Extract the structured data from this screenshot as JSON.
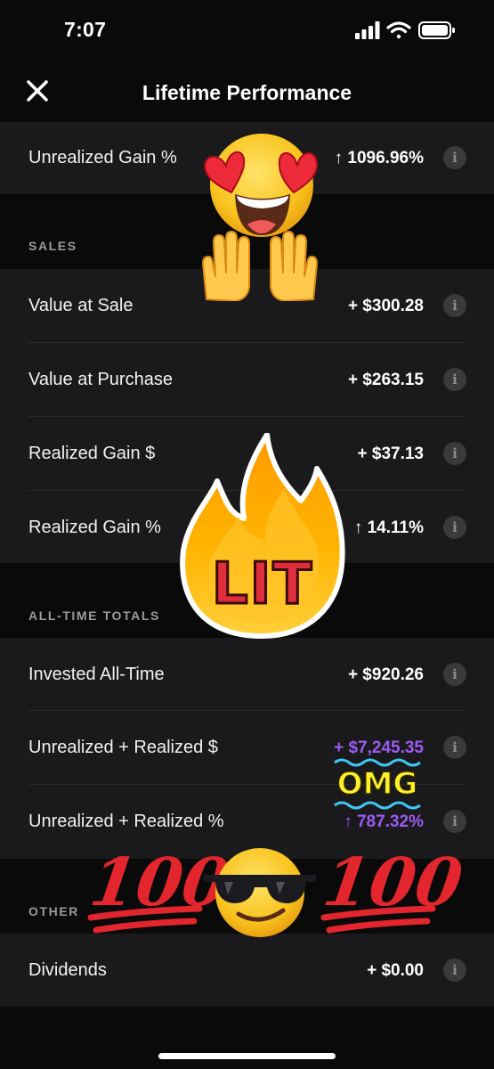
{
  "status_bar": {
    "time": "7:07"
  },
  "nav": {
    "title": "Lifetime Performance",
    "close_icon": "close-icon"
  },
  "top_row": {
    "label": "Unrealized Gain %",
    "value": "↑ 1096.96%"
  },
  "sales": {
    "header": "SALES",
    "rows": [
      {
        "label": "Value at Sale",
        "value": "+ $300.28"
      },
      {
        "label": "Value at Purchase",
        "value": "+ $263.15"
      },
      {
        "label": "Realized Gain $",
        "value": "+ $37.13"
      },
      {
        "label": "Realized Gain %",
        "value": "↑ 14.11%"
      }
    ]
  },
  "totals": {
    "header": "ALL-TIME TOTALS",
    "rows": [
      {
        "label": "Invested All-Time",
        "value": "+ $920.26"
      },
      {
        "label": "Unrealized + Realized $",
        "value": "+ $7,245.35"
      },
      {
        "label": "Unrealized + Realized %",
        "value": "↑ 787.32%"
      }
    ]
  },
  "other": {
    "header": "OTHER",
    "rows": [
      {
        "label": "Dividends",
        "value": "+ $0.00"
      }
    ]
  },
  "stickers": {
    "lit": "LIT",
    "omg": "OMG",
    "hundred_left": "100",
    "hundred_right": "100"
  },
  "colors": {
    "background": "#0a0a0b",
    "section": "#1a1a1c",
    "accent_purple": "#9b5cf2",
    "info_icon": "#3a3a3d"
  }
}
